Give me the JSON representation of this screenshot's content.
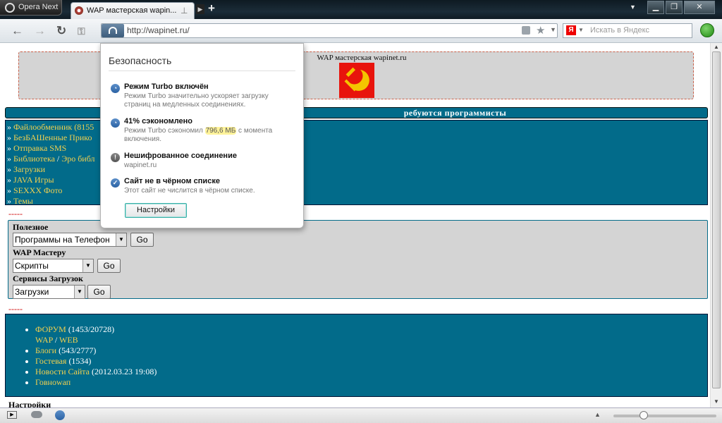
{
  "browser": {
    "menu_button": "Opera Next",
    "tab_title": "WAP мастерская wapin...",
    "new_tab": "+",
    "url": "http://wapinet.ru/",
    "search_placeholder": "Искать в Яндекс",
    "search_engine_glyph": "Я",
    "window_controls": {
      "minimize": "▁",
      "restore": "❐",
      "close": "✕"
    }
  },
  "security_popup": {
    "title": "Безопасность",
    "items": [
      {
        "icon": "turbo-icon",
        "title": "Режим Turbo включён",
        "desc": "Режим Turbo значительно ускоряет загрузку страниц на медленных соединениях."
      },
      {
        "icon": "turbo-icon",
        "title": "41% сэкономлено",
        "desc_before": "Режим Turbo сэкономил ",
        "desc_highlight": "796,6 МБ",
        "desc_after": " с момента включения."
      },
      {
        "icon": "warning-icon",
        "title": "Нешифрованное соединение",
        "desc": "wapinet.ru"
      },
      {
        "icon": "check-icon",
        "title": "Сайт не в чёрном списке",
        "desc": "Этот сайт не числится в чёрном списке."
      }
    ],
    "settings_button": "Настройки"
  },
  "page": {
    "site_title": "WAP мастерская wapinet.ru",
    "announcement": "ребуются программисты",
    "menu_items": [
      {
        "prefix": "» ",
        "label": "Файлообменник (8155"
      },
      {
        "prefix": "» ",
        "label": "БезБАШенные Прико"
      },
      {
        "prefix": "» ",
        "label": "Отправка SMS"
      },
      {
        "prefix": "» ",
        "label": "Библиотека",
        "sep": " / ",
        "label2": "Эро библ"
      },
      {
        "prefix": "» ",
        "label": "Загрузки"
      },
      {
        "prefix": "» ",
        "label": "JAVA Игры"
      },
      {
        "prefix": "» ",
        "label": "SEXXX Фото"
      },
      {
        "prefix": "» ",
        "label": "Темы"
      }
    ],
    "divider": "-----",
    "forms": [
      {
        "label": "Полезное",
        "selected": "Программы на Телефон",
        "go": "Go"
      },
      {
        "label": "WAP Мастеру",
        "selected": "Скрипты",
        "go": "Go"
      },
      {
        "label": "Сервисы Загрузок",
        "selected": "Загрузки",
        "go": "Go"
      }
    ],
    "links": {
      "forum": {
        "label": "ФОРУМ",
        "count": " (1453/20728)"
      },
      "wap": "WAP",
      "web": "WEB",
      "blogs": {
        "label": "Блоги",
        "count": " (543/2777)"
      },
      "guestbook": {
        "label": "Гостевая",
        "count": " (1534)"
      },
      "news": {
        "label": "Новости Сайта",
        "count": " (2012.03.23 19:08)"
      },
      "govnowap": {
        "label": "Говноwап"
      }
    },
    "settings_label": "Настройки"
  },
  "colors": {
    "accent": "#026b8a",
    "link": "#f0d050",
    "logo": "#e8140c",
    "highlight": "#fff39a"
  }
}
